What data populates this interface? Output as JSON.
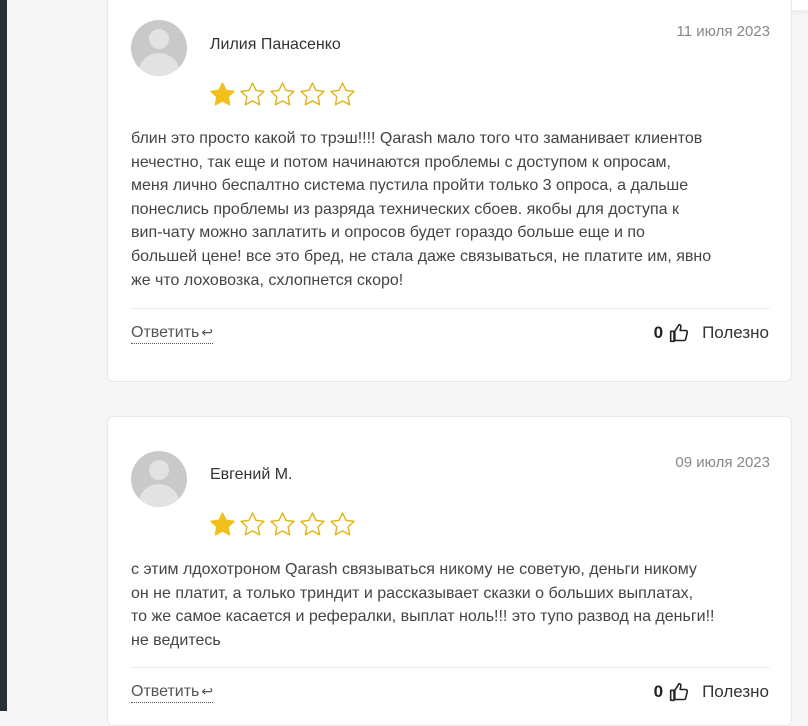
{
  "colors": {
    "star_filled": "#f2c01a",
    "star_empty_stroke": "#e3b51a",
    "accent_text": "#444444"
  },
  "reviews": [
    {
      "author": "Лилия Панасенко",
      "date": "11 июля 2023",
      "rating": 1,
      "max_rating": 5,
      "text": "блин это просто какой то трэш!!!! Qarash мало того что заманивает клиентов\nнечестно, так еще и потом начинаются проблемы с доступом к опросам,\nменя лично беспалтно система пустила пройти только 3 опроса, а дальше\nпонеслись проблемы из разряда технических сбоев. якобы для доступа к\nвип-чату можно заплатить и опросов будет гораздо больше еще и по\nбольшей цене! все это бред, не стала даже связываться, не платите им, явно\nже что лоховозка, схлопнется скоро!",
      "reply_label": "Ответить",
      "helpful_count": "0",
      "helpful_label": "Полезно"
    },
    {
      "author": "Евгений М.",
      "date": "09 июля 2023",
      "rating": 1,
      "max_rating": 5,
      "text": "с этим лдохотроном Qarash связываться никому не советую, деньги никому\nон не платит, а только триндит и рассказывает сказки о больших выплатах,\nто же самое касается и рефералки, выплат ноль!!! это тупо развод на деньги!!\nне ведитесь",
      "reply_label": "Ответить",
      "helpful_count": "0",
      "helpful_label": "Полезно"
    }
  ]
}
